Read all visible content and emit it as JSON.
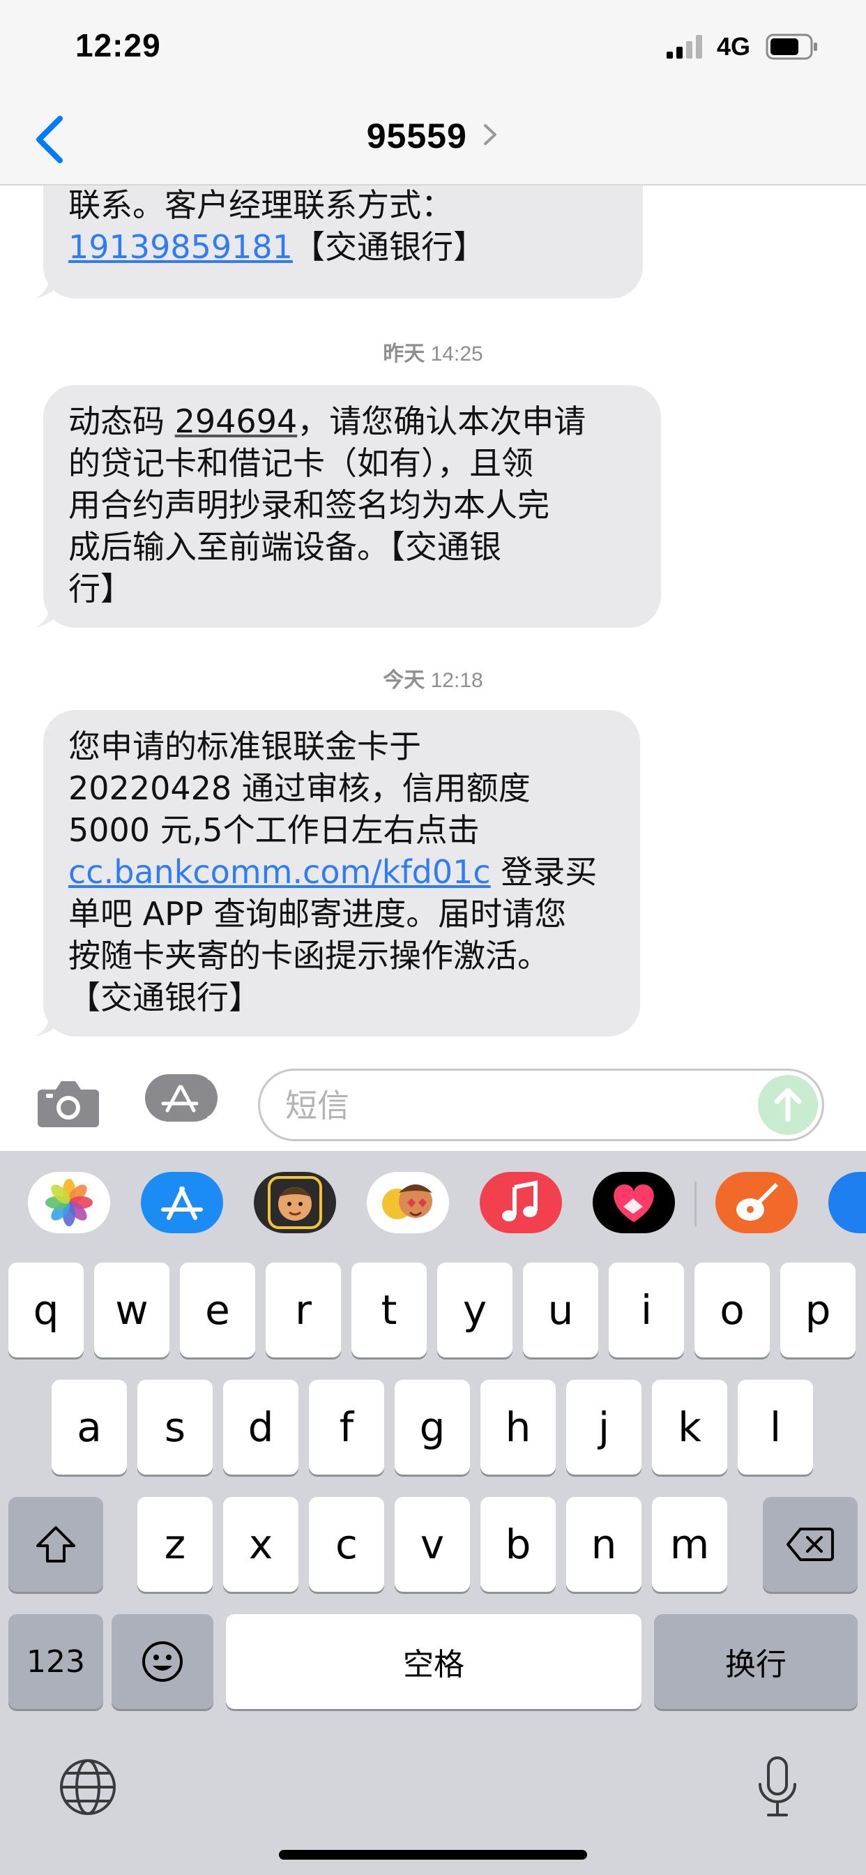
{
  "status_bar": {
    "time": "12:29",
    "network": "4G"
  },
  "header": {
    "contact": "95559"
  },
  "messages": [
    {
      "lines": [
        "联系。客户经理联系方式："
      ],
      "phone_link": "19139859181",
      "suffix": "【交通银行】"
    },
    {
      "timestamp_day": "昨天",
      "timestamp_time": "14:25",
      "prefix": "动态码 ",
      "code": "294694",
      "lines": [
        "，请您确认本次申请",
        "的贷记卡和借记卡（如有），且领",
        "用合约声明抄录和签名均为本人完",
        "成后输入至前端设备。【交通银",
        "行】"
      ]
    },
    {
      "timestamp_day": "今天",
      "timestamp_time": "12:18",
      "lines": [
        "您申请的标准银联金卡于",
        "20220428 通过审核，信用额度",
        "5000 元,5个工作日左右点击"
      ],
      "url": "cc.bankcomm.com/kfd01c",
      "after_url": " 登录买",
      "lines2": [
        "单吧 APP 查询邮寄进度。届时请您",
        "按随卡夹寄的卡函提示操作激活。",
        "【交通银行】"
      ]
    }
  ],
  "input": {
    "placeholder": "短信"
  },
  "app_drawer": [
    "photos-app",
    "app-store",
    "memoji",
    "memoji-stickers",
    "music",
    "digital-touch",
    "garageband",
    "partial-app"
  ],
  "keyboard": {
    "row1": [
      "q",
      "w",
      "e",
      "r",
      "t",
      "y",
      "u",
      "i",
      "o",
      "p"
    ],
    "row2": [
      "a",
      "s",
      "d",
      "f",
      "g",
      "h",
      "j",
      "k",
      "l"
    ],
    "row3": [
      "z",
      "x",
      "c",
      "v",
      "b",
      "n",
      "m"
    ],
    "numbers_label": "123",
    "space_label": "空格",
    "return_label": "换行"
  },
  "colors": {
    "link": "#2f7cf6",
    "bubble": "#e9e9eb",
    "accent": "#007aff",
    "send_disabled": "#c9ecd1"
  }
}
